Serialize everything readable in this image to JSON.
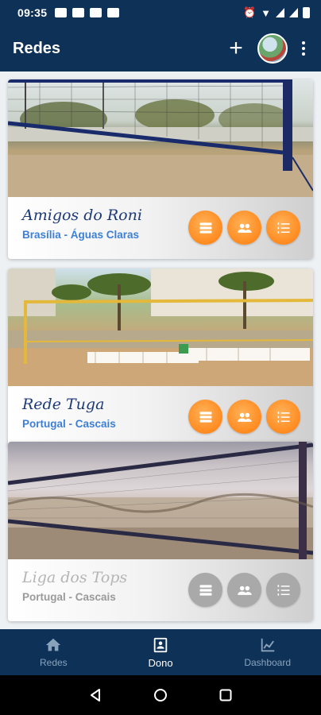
{
  "status_bar": {
    "time": "09:35"
  },
  "app_bar": {
    "title": "Redes"
  },
  "cards": [
    {
      "name": "Amigos do Roni",
      "location": "Brasília - Águas Claras",
      "enabled": true
    },
    {
      "name": "Rede Tuga",
      "location": "Portugal -  Cascais",
      "enabled": true
    },
    {
      "name": "Liga dos Tops",
      "location": "Portugal -  Cascais",
      "enabled": false
    }
  ],
  "card_actions": [
    "list-view-icon",
    "group-icon",
    "numbered-list-icon"
  ],
  "bottom_nav": [
    {
      "label": "Redes",
      "icon": "home-icon",
      "active": false
    },
    {
      "label": "Dono",
      "icon": "contact-card-icon",
      "active": true
    },
    {
      "label": "Dashboard",
      "icon": "chart-icon",
      "active": false
    }
  ],
  "colors": {
    "primary": "#0e3157",
    "accent": "#ff8a1f",
    "link": "#3d7fd6",
    "title": "#1d3a78"
  }
}
